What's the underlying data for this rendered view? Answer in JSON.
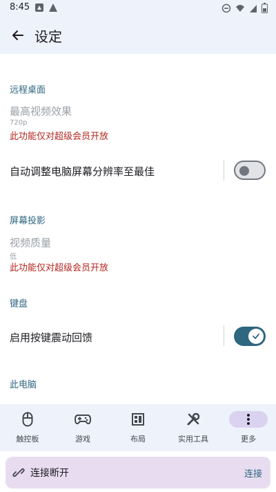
{
  "status_bar": {
    "time": "8:45"
  },
  "header": {
    "title": "设定"
  },
  "sections": {
    "remote_desktop": {
      "label": "远程桌面",
      "video_quality": {
        "title": "最高视频效果",
        "value": "720p",
        "notice": "此功能仅对超级会员开放"
      },
      "auto_resolution": {
        "title": "自动调整电脑屏幕分辨率至最佳",
        "enabled": false
      }
    },
    "screen_projection": {
      "label": "屏幕投影",
      "video_quality": {
        "title": "视频质量",
        "value": "低",
        "notice": "此功能仅对超级会员开放"
      }
    },
    "keyboard": {
      "label": "键盘",
      "vibration": {
        "title": "启用按键震动回馈",
        "enabled": true
      }
    },
    "this_pc": {
      "label": "此电脑"
    }
  },
  "bottom_nav": [
    {
      "label": "触控板",
      "icon": "mouse-icon",
      "active": false
    },
    {
      "label": "游戏",
      "icon": "gamepad-icon",
      "active": false
    },
    {
      "label": "布局",
      "icon": "layout-icon",
      "active": false
    },
    {
      "label": "实用工具",
      "icon": "tools-icon",
      "active": false
    },
    {
      "label": "更多",
      "icon": "more-vert-icon",
      "active": true
    }
  ],
  "connection": {
    "status": "连接断开",
    "action": "连接"
  },
  "colors": {
    "accent": "#2f6680",
    "warning": "#b3261e",
    "nav_bg": "#eef2fa",
    "active_pill": "#d9d3f0",
    "connection_bg": "#e8ddf0"
  }
}
